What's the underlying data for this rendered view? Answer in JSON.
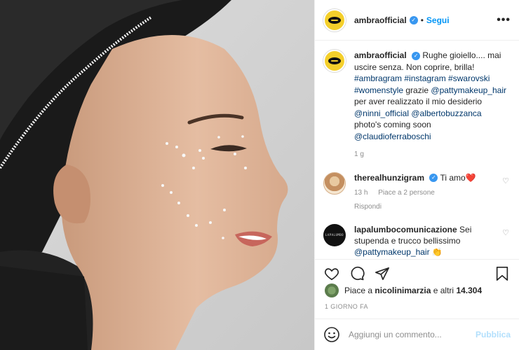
{
  "header": {
    "username": "ambraofficial",
    "separator": "•",
    "follow_label": "Segui",
    "more_label": "•••"
  },
  "caption": {
    "username": "ambraofficial",
    "text": "Rughe gioiello.... mai uscire senza. Non coprire, brilla!",
    "hashtags": "#ambragram #instagram #swarovski #womenstyle",
    "after_hashtags": "grazie",
    "mention1": "@pattymakeup_hair",
    "after_mention1": "per aver realizzato il mio desiderio",
    "mention2": "@ninni_official",
    "mention3": "@albertobuzzanca",
    "line_photo": "photo's coming soon",
    "mention4": "@claudioferraboschi",
    "time": "1 g"
  },
  "comments": [
    {
      "username": "therealhunzigram",
      "text": "Ti amo❤️",
      "time": "13 h",
      "likes": "Piace a 2 persone",
      "reply": "Rispondi"
    },
    {
      "username": "lapalumbocomunicazione",
      "text": "Sei stupenda e trucco bellissimo",
      "mention": "@pattymakeup_hair",
      "emoji": "👏"
    }
  ],
  "likes": {
    "prefix": "Piace a",
    "user": "nicolinimarzia",
    "middle": "e altri",
    "count": "14.304"
  },
  "date": "1 GIORNO FA",
  "add_comment": {
    "placeholder": "Aggiungi un commento...",
    "publish_label": "Pubblica"
  },
  "icons": [
    "avatar-lips-icon",
    "verified-icon",
    "heart-icon",
    "comment-icon",
    "share-icon",
    "bookmark-icon",
    "emoji-icon"
  ],
  "colors": {
    "accent": "#0095f6",
    "verified": "#3897f0",
    "publish_disabled": "#b2dffc",
    "avatar_bg": "#f4cf2b"
  }
}
